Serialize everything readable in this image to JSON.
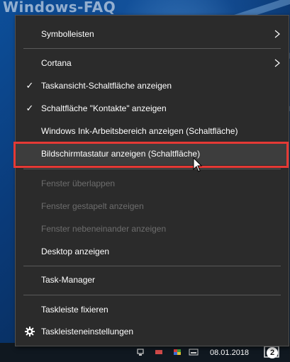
{
  "watermark": "Windows-FAQ",
  "menu": {
    "items": [
      {
        "label": "Symbolleisten",
        "submenu": true
      },
      {
        "label": "Cortana",
        "submenu": true
      },
      {
        "label": "Taskansicht-Schaltfläche anzeigen",
        "checked": true
      },
      {
        "label": "Schaltfläche \"Kontakte\" anzeigen",
        "checked": true
      },
      {
        "label": "Windows Ink-Arbeitsbereich anzeigen (Schaltfläche)"
      },
      {
        "label": "Bildschirmtastatur anzeigen (Schaltfläche)",
        "highlighted": true
      },
      {
        "label": "Fenster überlappen",
        "disabled": true
      },
      {
        "label": "Fenster gestapelt anzeigen",
        "disabled": true
      },
      {
        "label": "Fenster nebeneinander anzeigen",
        "disabled": true
      },
      {
        "label": "Desktop anzeigen"
      },
      {
        "label": "Task-Manager"
      },
      {
        "label": "Taskleiste fixieren"
      },
      {
        "label": "Taskleisteneinstellungen",
        "icon": "gear-icon"
      }
    ]
  },
  "taskbar": {
    "date": "08.01.2018",
    "notification_count": "2"
  },
  "colors": {
    "menu_bg": "#2b2b2b",
    "menu_text": "#ffffff",
    "disabled_text": "#6d6d6d",
    "highlight_border": "#e53935"
  }
}
